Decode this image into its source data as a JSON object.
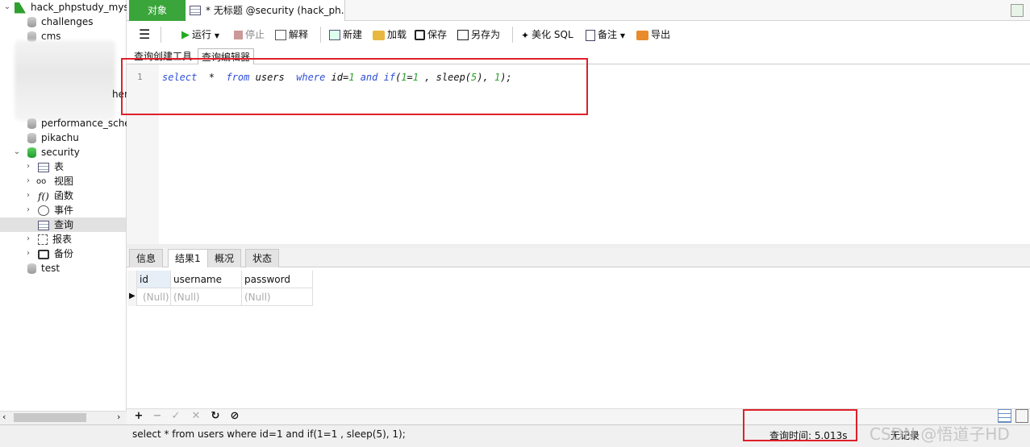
{
  "tree": {
    "connection": "hack_phpstudy_mysc",
    "databases": {
      "challenges": "challenges",
      "cms": "cms",
      "partial_her": "her",
      "performance_schema": "performance_sche",
      "pikachu": "pikachu",
      "security": "security",
      "test": "test"
    },
    "security_children": {
      "tables": "表",
      "views": "视图",
      "functions": "函数",
      "events": "事件",
      "queries": "查询",
      "reports": "报表",
      "backups": "备份"
    }
  },
  "tabs": {
    "object": "对象",
    "query_tab": "* 无标题 @security (hack_ph..."
  },
  "toolbar": {
    "run": "运行",
    "stop": "停止",
    "explain": "解释",
    "new": "新建",
    "load": "加载",
    "save": "保存",
    "save_as": "另存为",
    "beautify": "美化 SQL",
    "comment": "备注",
    "export": "导出"
  },
  "subtabs": {
    "builder": "查询创建工具",
    "editor": "查询编辑器"
  },
  "editor": {
    "line_number": "1"
  },
  "result_tabs": {
    "info": "信息",
    "result1": "结果1",
    "overview": "概况",
    "status": "状态"
  },
  "grid": {
    "columns": [
      "id",
      "username",
      "password"
    ],
    "row": [
      "(Null)",
      "(Null)",
      "(Null)"
    ]
  },
  "status": {
    "sql": "select  *  from users  where id=1 and if(1=1 , sleep(5), 1);",
    "query_time": "查询时间: 5.013s",
    "no_records": "无记录"
  },
  "watermark": "CSDN @悟道子HD",
  "colors": {
    "accent_green": "#3aa53a",
    "keyword_blue": "#2f4fd8",
    "number_green": "#2aa22a",
    "highlight_red": "#e0202a"
  }
}
